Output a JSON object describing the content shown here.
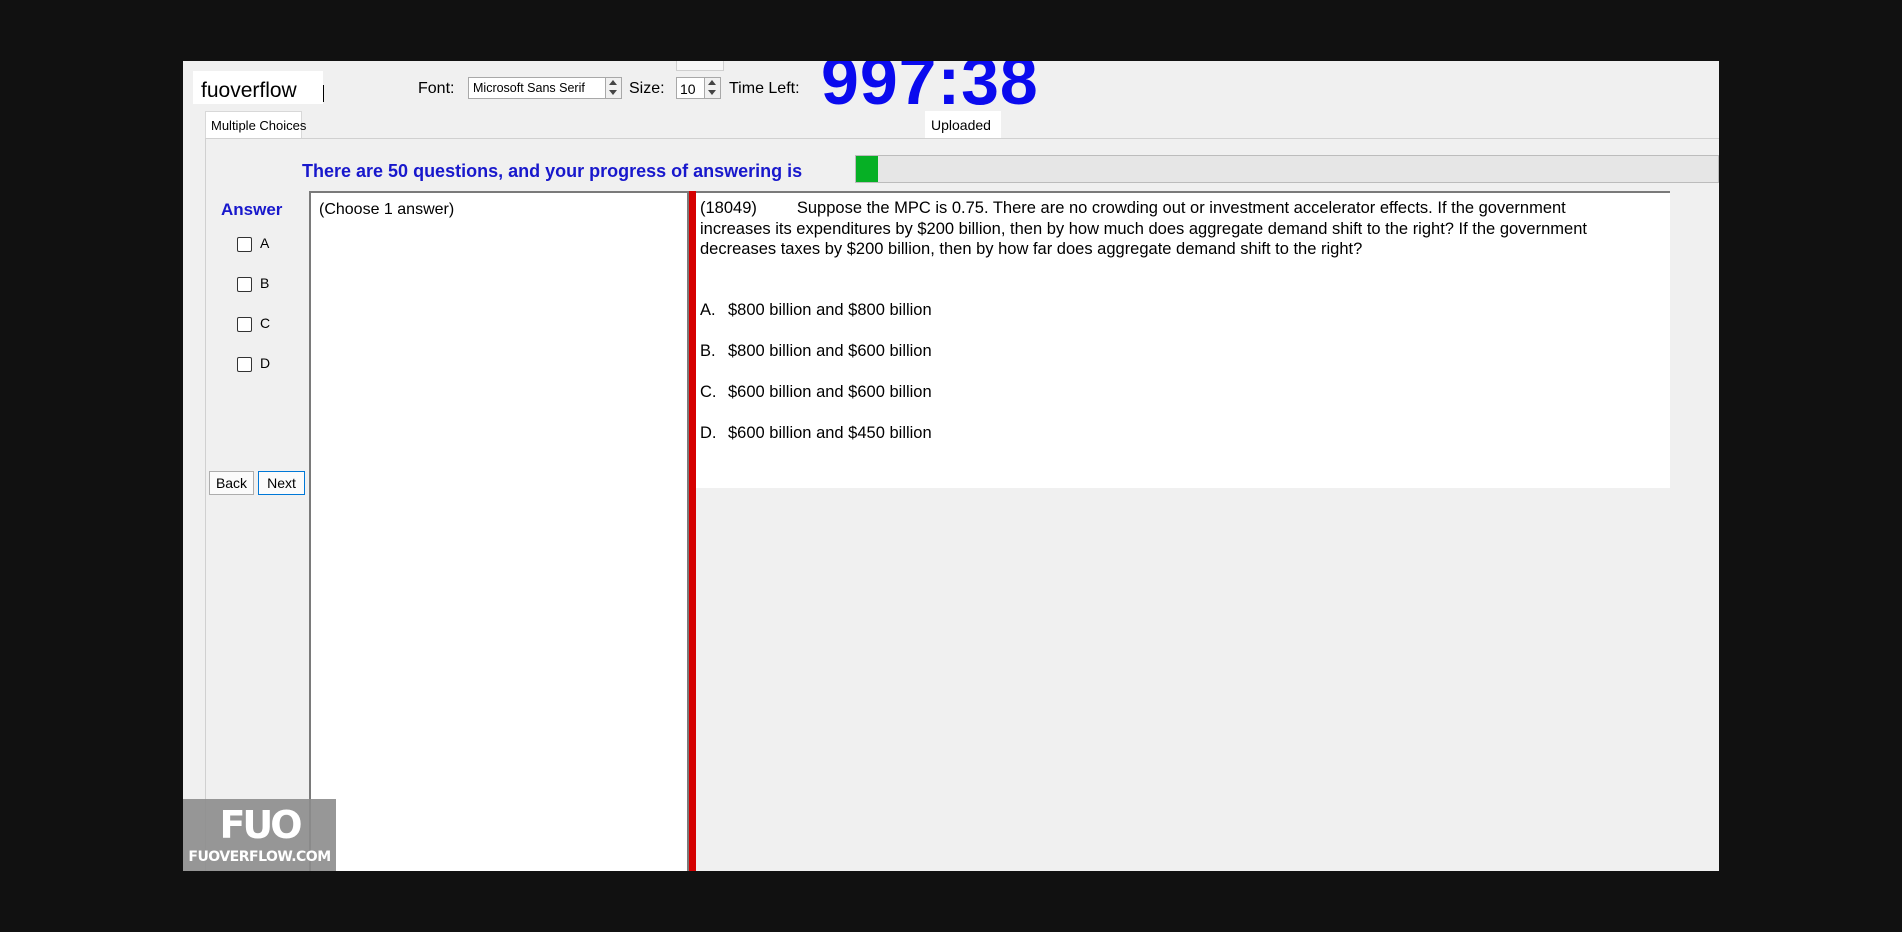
{
  "header": {
    "username": "fuoverflow",
    "font_label": "Font:",
    "font_value": "Microsoft Sans Serif",
    "size_label": "Size:",
    "size_value": "10",
    "time_left_label": "Time Left:",
    "timer": "997:38"
  },
  "tabs": {
    "multiple_choices": "Multiple Choices",
    "uploaded": "Uploaded"
  },
  "progress": {
    "text": "There are 50 questions, and your progress of answering is",
    "total_questions": 50,
    "fraction_answered": 0.025,
    "fill_color": "#06b025"
  },
  "answer_panel": {
    "heading": "Answer",
    "options": [
      "A",
      "B",
      "C",
      "D"
    ],
    "back_label": "Back",
    "next_label": "Next"
  },
  "choice_hint": "(Choose 1 answer)",
  "question": {
    "number": "(18049)",
    "text": "Suppose the MPC is 0.75. There are no crowding out or investment accelerator effects. If the government increases its expenditures by $200 billion, then by how much does aggregate demand shift to the right? If the government decreases taxes by $200 billion, then by how far does aggregate demand shift to the right?",
    "answers": [
      {
        "letter": "A.",
        "text": "$800 billion and $800 billion"
      },
      {
        "letter": "B.",
        "text": "$800 billion and $600 billion"
      },
      {
        "letter": "C.",
        "text": "$600 billion and $600 billion"
      },
      {
        "letter": "D.",
        "text": "$600 billion and $450 billion"
      }
    ]
  },
  "watermark": {
    "logo": "FUO",
    "site": "FUOVERFLOW.COM"
  },
  "colors": {
    "timer": "#0a0aee",
    "heading_blue": "#1818cc",
    "separator_red": "#d50000"
  }
}
